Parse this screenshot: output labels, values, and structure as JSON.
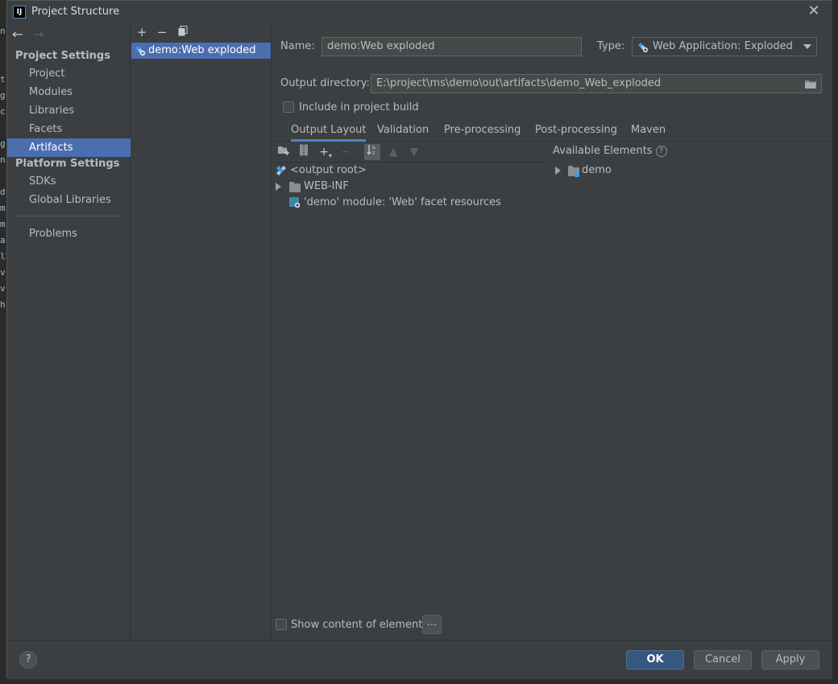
{
  "window": {
    "title": "Project Structure",
    "app_icon_text": "IJ"
  },
  "background_editor_glyphs": [
    "n",
    "t",
    "g",
    "c",
    "g",
    "n",
    "d",
    "m",
    "m",
    "a",
    "l.",
    "v",
    "v",
    "h"
  ],
  "nav": {
    "project_settings_header": "Project Settings",
    "project_items": [
      "Project",
      "Modules",
      "Libraries",
      "Facets",
      "Artifacts"
    ],
    "selected": "Artifacts",
    "platform_settings_header": "Platform Settings",
    "platform_items": [
      "SDKs",
      "Global Libraries"
    ],
    "problems": "Problems"
  },
  "artifacts": {
    "items": [
      "demo:Web exploded"
    ]
  },
  "form": {
    "name_label": "Name:",
    "name_value": "demo:Web exploded",
    "type_label": "Type:",
    "type_value": "Web Application: Exploded",
    "output_label": "Output directory:",
    "output_value": "E:\\project\\ms\\demo\\out\\artifacts\\demo_Web_exploded",
    "include_label": "Include in project build",
    "include_checked": false
  },
  "tabs": [
    "Output Layout",
    "Validation",
    "Pre-processing",
    "Post-processing",
    "Maven"
  ],
  "active_tab": "Output Layout",
  "layout_tree": [
    {
      "label": "<output root>",
      "icon": "output-root-icon"
    },
    {
      "label": "WEB-INF",
      "icon": "folder-icon"
    },
    {
      "label": "'demo' module: 'Web' facet resources",
      "icon": "facet-resource-icon"
    }
  ],
  "available": {
    "header": "Available Elements",
    "items": [
      "demo"
    ]
  },
  "bottom": {
    "show_content_label": "Show content of elements",
    "show_content_checked": false,
    "dots_label": "..."
  },
  "footer": {
    "help": "?",
    "ok": "OK",
    "cancel": "Cancel",
    "apply": "Apply"
  },
  "colors": {
    "selection": "#4b6eaf",
    "background": "#3c3f41",
    "default_button": "#365880",
    "tab_indicator": "#4a88c7"
  }
}
